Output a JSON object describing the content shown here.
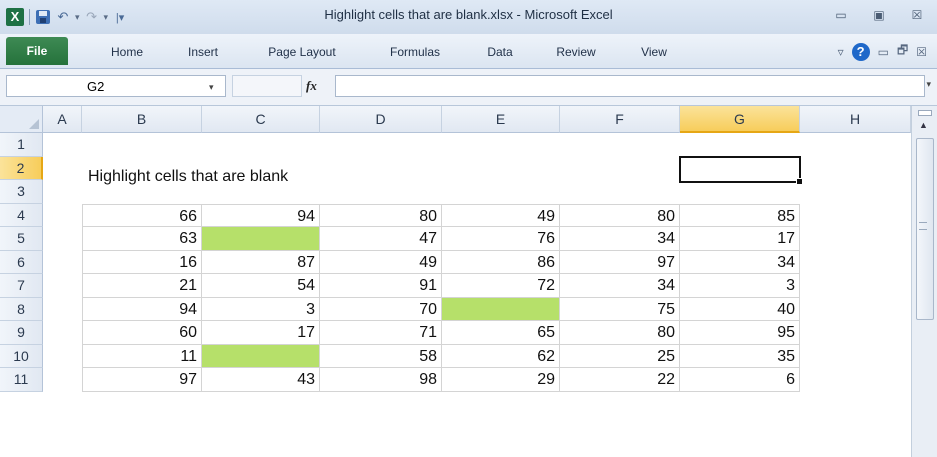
{
  "window": {
    "title": "Highlight cells that are blank.xlsx - Microsoft Excel",
    "app_logo": "X",
    "controls": {
      "minimize": "▭",
      "restore": "▣",
      "close": "☒"
    }
  },
  "qat": {
    "icons": [
      "excel-icon",
      "save-icon",
      "undo-icon",
      "redo-icon",
      "customize-qat-icon"
    ],
    "undo": "↶",
    "redo": "↷",
    "dropdown": "▾",
    "customize": "|▾"
  },
  "ribbon": {
    "tabs": [
      "File",
      "Home",
      "Insert",
      "Page Layout",
      "Formulas",
      "Data",
      "Review",
      "View"
    ],
    "right_icons": {
      "minimize_ribbon": "▿",
      "help": "?",
      "app_minimize": "▭",
      "app_restore": "🗗",
      "app_close": "☒"
    }
  },
  "formula_bar": {
    "name_box": "G2",
    "fx": "fx",
    "formula": ""
  },
  "sheet": {
    "columns": [
      "A",
      "B",
      "C",
      "D",
      "E",
      "F",
      "G",
      "H"
    ],
    "rows": [
      "1",
      "2",
      "3",
      "4",
      "5",
      "6",
      "7",
      "8",
      "9",
      "10",
      "11"
    ],
    "selected_column": "G",
    "selected_row": "2",
    "title_text": "Highlight cells that are blank",
    "highlight_color": "#b6e06a",
    "selection_color": "#f7cd5b",
    "data": [
      [
        66,
        94,
        80,
        49,
        80,
        85
      ],
      [
        63,
        null,
        47,
        76,
        34,
        17
      ],
      [
        16,
        87,
        49,
        86,
        97,
        34
      ],
      [
        21,
        54,
        91,
        72,
        34,
        3
      ],
      [
        94,
        3,
        70,
        null,
        75,
        40
      ],
      [
        60,
        17,
        71,
        65,
        80,
        95
      ],
      [
        11,
        null,
        58,
        62,
        25,
        35
      ],
      [
        97,
        43,
        98,
        29,
        22,
        6
      ]
    ]
  }
}
